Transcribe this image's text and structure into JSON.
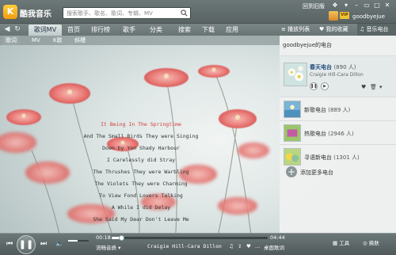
{
  "colors": {
    "accent": "#d23a3a",
    "titlebar": "#596364",
    "brand": "#f39a10",
    "link": "#1e4a7a"
  },
  "app": {
    "logo": "K",
    "title": "酷我音乐"
  },
  "search": {
    "placeholder": "搜索歌手、歌名、歌词、专辑、MV"
  },
  "titlebar": {
    "back_old": "回到旧版",
    "username": "goodbyejue",
    "vip": "VIP"
  },
  "nav": {
    "tabs": [
      {
        "label": "歌词MV",
        "active": true
      },
      {
        "label": "首页"
      },
      {
        "label": "排行榜"
      },
      {
        "label": "歌手"
      },
      {
        "label": "分类"
      },
      {
        "label": "搜索"
      },
      {
        "label": "下载"
      },
      {
        "label": "应用"
      }
    ]
  },
  "subtabs": [
    {
      "label": "歌词",
      "active": true
    },
    {
      "label": "MV"
    },
    {
      "label": "K歌"
    },
    {
      "label": "斜槽"
    }
  ],
  "lyrics": [
    {
      "text": "It Being In The Springtime",
      "current": true
    },
    {
      "text": "And The Small Birds They were Singing"
    },
    {
      "text": "Down by Yon Shady Harbour"
    },
    {
      "text": "I Carelessly did Stray"
    },
    {
      "text": "The Thrushes They were Warbling"
    },
    {
      "text": "The Violets They were Charming"
    },
    {
      "text": "To View Fond Lovers Talking"
    },
    {
      "text": "A While I did Delay"
    },
    {
      "text": "She Said My Dear Don't Leave Me"
    }
  ],
  "rpanel": {
    "tabs": [
      {
        "label": "播放列表",
        "icon": "list-icon"
      },
      {
        "label": "我的收藏",
        "icon": "heart-icon"
      },
      {
        "label": "音乐电台",
        "icon": "radio-icon",
        "active": true
      }
    ],
    "my_radio": "goodbyejue的电台",
    "playing": {
      "name": "春天电台",
      "count": "(890 人)",
      "now": "Craigie Hill-Cara Dillon"
    },
    "stations": [
      {
        "name": "新歌电台",
        "count": "(889 人)"
      },
      {
        "name": "热歌电台",
        "count": "(2946 人)"
      },
      {
        "name": "寻语新电台",
        "count": "(1301 人)"
      }
    ],
    "add_more": "添加更多电台"
  },
  "player": {
    "elapsed": "00:18",
    "total": "04:44",
    "progress": 0.063,
    "volume": 0.45,
    "quality": "流畅音质",
    "now_playing": "Craigie Hill-Cara Dillon",
    "desktop_lyrics": "桌面歌词",
    "tools": "工具",
    "skin": "换肤"
  }
}
